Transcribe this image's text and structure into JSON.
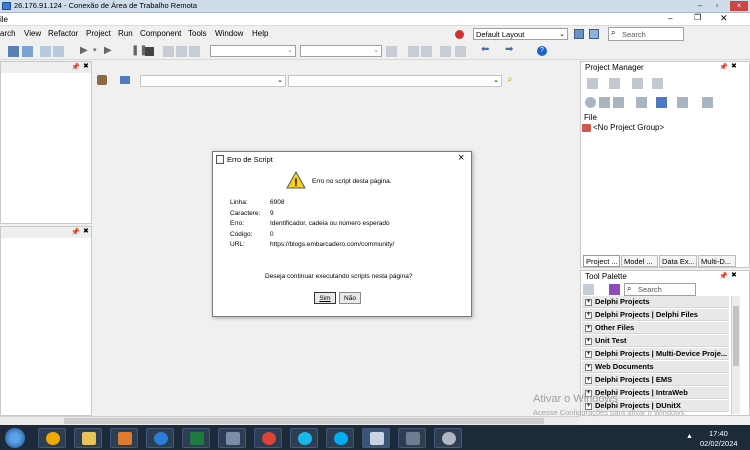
{
  "window": {
    "title": "26.176.91.124 - Conexão de Área de Trabalho Remota",
    "app_caption": "ile"
  },
  "menu": [
    "arch",
    "View",
    "Refactor",
    "Project",
    "Run",
    "Component",
    "Tools",
    "Window",
    "Help"
  ],
  "layout_combo": "Default Layout",
  "search": {
    "placeholder": "Search"
  },
  "project_manager": {
    "title": "Project Manager",
    "file_label": "File",
    "group_label": "<No Project Group>",
    "tabs": [
      "Project ...",
      "Model ...",
      "Data Ex...",
      "Multi-D..."
    ]
  },
  "tool_palette": {
    "title": "Tool Palette",
    "search_placeholder": "Search",
    "items": [
      "Delphi Projects",
      "Delphi Projects | Delphi Files",
      "Other Files",
      "Unit Test",
      "Delphi Projects | Multi-Device Proje...",
      "Web Documents",
      "Delphi Projects | EMS",
      "Delphi Projects | IntraWeb",
      "Delphi Projects | DUnitX"
    ]
  },
  "dialog": {
    "title": "Erro de Script",
    "heading": "Erro no script desta página.",
    "fields": [
      {
        "label": "Linha:",
        "value": "6908"
      },
      {
        "label": "Caractere:",
        "value": "9"
      },
      {
        "label": "Erro:",
        "value": "Identificador, cadeia ou número esperado"
      },
      {
        "label": "Código:",
        "value": "0"
      },
      {
        "label": "URL:",
        "value": "https://blogs.embarcadero.com/community/"
      }
    ],
    "question": "Deseja continuar executando scripts nesta página?",
    "yes": "Sim",
    "no": "Não"
  },
  "watermark": {
    "line1": "Ativar o Windows",
    "line2": "Acesse Configurações para ativar o Windows."
  },
  "clock": {
    "time": "17:40",
    "date": "02/02/2024"
  },
  "colors": {
    "titlebar": "#cfdcea",
    "taskbar": "#1d2a3a",
    "accent": "#1e63c4"
  }
}
